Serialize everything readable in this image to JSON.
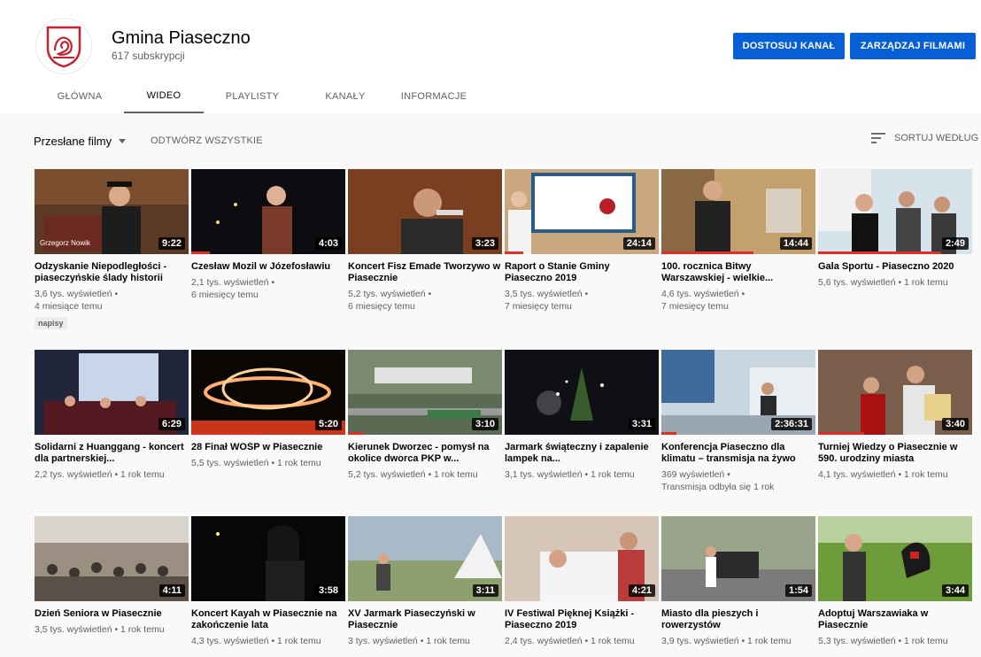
{
  "channel": {
    "name": "Gmina Piaseczno",
    "subscribers": "617 subskrypcji",
    "customize_label": "DOSTOSUJ KANAŁ",
    "manage_label": "ZARZĄDZAJ FILMAMI"
  },
  "tabs": [
    {
      "label": "GŁÓWNA",
      "active": false
    },
    {
      "label": "WIDEO",
      "active": true
    },
    {
      "label": "PLAYLISTY",
      "active": false
    },
    {
      "label": "KANAŁY",
      "active": false
    },
    {
      "label": "INFORMACJE",
      "active": false
    }
  ],
  "filter": {
    "selected": "Przesłane filmy",
    "play_all": "ODTWÓRZ WSZYSTKIE",
    "sort": "SORTUJ WEDŁUG"
  },
  "colors": {
    "accent": "#065fd4",
    "progress": "#e52d27",
    "logo": "#c8202f"
  },
  "videos": [
    {
      "title": "Odzyskanie Niepodległości - piaseczyńskie ślady historii",
      "meta1": "3,6 tys. wyświetleń •",
      "meta2": "4 miesiące temu",
      "badge": "napisy",
      "duration": "9:22",
      "progress": 0.0,
      "thumb_overlay": "Grzegorz Nowik"
    },
    {
      "title": "Czesław Mozil w Józefosławiu",
      "meta1": "2,1 tys. wyświetleń •",
      "meta2": "6 miesięcy temu",
      "duration": "4:03",
      "progress": 0.12
    },
    {
      "title": "Koncert Fisz Emade Tworzywo w Piasecznie",
      "meta1": "5,2 tys. wyświetleń •",
      "meta2": "6 miesięcy temu",
      "duration": "3:23",
      "progress": 0.0
    },
    {
      "title": "Raport o Stanie Gminy Piaseczno 2019",
      "meta1": "3,5 tys. wyświetleń •",
      "meta2": "7 miesięcy temu",
      "duration": "24:14",
      "progress": 0.12
    },
    {
      "title": "100. rocznica Bitwy Warszawskiej - wielkie...",
      "meta1": "4,6 tys. wyświetleń •",
      "meta2": "7 miesięcy temu",
      "duration": "14:44",
      "progress": 0.6
    },
    {
      "title": "Gala Sportu - Piaseczno 2020",
      "meta1": "5,6 tys. wyświetleń • 1 rok temu",
      "duration": "2:49",
      "progress": 0.8
    },
    {
      "title": "Solidarni z Huanggang - koncert dla partnerskiej...",
      "meta1": "2,2 tys. wyświetleń • 1 rok temu",
      "duration": "6:29",
      "progress": 0.0
    },
    {
      "title": "28 Finał WOŚP w Piasecznie",
      "meta1": "5,5 tys. wyświetleń • 1 rok temu",
      "duration": "5:20",
      "progress": 0.45
    },
    {
      "title": "Kierunek Dworzec - pomysł na okolice dworca PKP w...",
      "meta1": "5,2 tys. wyświetleń • 1 rok temu",
      "duration": "3:10",
      "progress": 0.1
    },
    {
      "title": "Jarmark świąteczny i zapalenie lampek na...",
      "meta1": "3,1 tys. wyświetleń • 1 rok temu",
      "duration": "3:31",
      "progress": 0.0
    },
    {
      "title": "Konferencja Piaseczno dla klimatu – transmisja na żywo",
      "meta1": "369 wyświetleń •",
      "meta2": "Transmisja odbyła się 1 rok",
      "duration": "2:36:31",
      "progress": 0.1
    },
    {
      "title": "Turniej Wiedzy o Piasecznie w 590. urodziny miasta",
      "meta1": "4,1 tys. wyświetleń • 1 rok temu",
      "duration": "3:40",
      "progress": 0.3
    },
    {
      "title": "Dzień Seniora w Piasecznie",
      "meta1": "3,5 tys. wyświetleń • 1 rok temu",
      "duration": "4:11",
      "progress": 0.0
    },
    {
      "title": "Koncert Kayah w Piasecznie na zakończenie lata",
      "meta1": "4,3 tys. wyświetleń • 1 rok temu",
      "duration": "3:58",
      "progress": 0.0
    },
    {
      "title": "XV Jarmark Piaseczyński w Piasecznie",
      "meta1": "3 tys. wyświetleń • 1 rok temu",
      "duration": "3:11",
      "progress": 0.0
    },
    {
      "title": "IV Festiwal Pięknej Książki - Piaseczno 2019",
      "meta1": "2,4 tys. wyświetleń • 1 rok temu",
      "duration": "4:21",
      "progress": 0.0
    },
    {
      "title": "Miasto dla pieszych i rowerzystów",
      "meta1": "3,9 tys. wyświetleń • 1 rok temu",
      "duration": "1:54",
      "progress": 0.0
    },
    {
      "title": "Adoptuj Warszawiaka w Piasecznie",
      "meta1": "5,3 tys. wyświetleń • 1 rok temu",
      "duration": "3:44",
      "progress": 0.0
    }
  ]
}
